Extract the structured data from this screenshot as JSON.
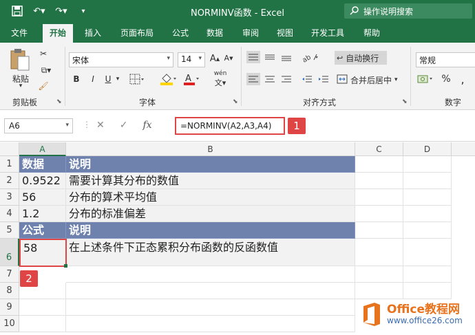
{
  "window": {
    "title": "NORMINV函数  -  Excel"
  },
  "tellme": {
    "label": "操作说明搜索"
  },
  "tabs": [
    "文件",
    "开始",
    "插入",
    "页面布局",
    "公式",
    "数据",
    "审阅",
    "视图",
    "开发工具",
    "帮助"
  ],
  "ribbon": {
    "clipboard": {
      "paste_label": "粘贴",
      "group_label": "剪贴板"
    },
    "font": {
      "name": "宋体",
      "size": "14",
      "bold": "B",
      "italic": "I",
      "underline": "U",
      "phonetic": "wén",
      "group_label": "字体"
    },
    "alignment": {
      "wrap_label": "自动换行",
      "merge_label": "合并后居中",
      "group_label": "对齐方式"
    },
    "number": {
      "format": "常规",
      "percent": "%",
      "group_label": "数字"
    }
  },
  "formula_bar": {
    "name_box": "A6",
    "cancel": "✕",
    "enter": "✓",
    "fx": "fx",
    "formula": "=NORMINV(A2,A3,A4)"
  },
  "callouts": {
    "one": "1",
    "two": "2"
  },
  "columns": [
    "A",
    "B",
    "C",
    "D"
  ],
  "rows": [
    "1",
    "2",
    "3",
    "4",
    "5",
    "6",
    "7",
    "8",
    "9",
    "10"
  ],
  "cells": {
    "r1": {
      "a": "数据",
      "b": "说明"
    },
    "r2": {
      "a": "0.9522",
      "b": "需要计算其分布的数值"
    },
    "r3": {
      "a": "56",
      "b": "分布的算术平均值"
    },
    "r4": {
      "a": "1.2",
      "b": "分布的标准偏差"
    },
    "r5": {
      "a": "公式",
      "b": "说明"
    },
    "r6": {
      "a": "58",
      "b": "在上述条件下正态累积分布函数的反函数值"
    }
  },
  "logo": {
    "line1": "Office教程网",
    "line2": "www.office26.com"
  },
  "colors": {
    "excel_green": "#217346",
    "header_band": "#6f82ae",
    "highlight_red": "#e04545",
    "logo_orange": "#e8731e",
    "logo_blue": "#3b6cb0"
  },
  "icons": [
    "save-icon",
    "undo-icon",
    "redo-icon",
    "customize-qat-icon",
    "search-icon",
    "cut-icon",
    "copy-icon",
    "format-painter-icon",
    "fill-color-icon",
    "font-color-icon",
    "wrap-text-icon",
    "merge-center-icon",
    "cancel-icon",
    "enter-icon",
    "fx-icon"
  ]
}
